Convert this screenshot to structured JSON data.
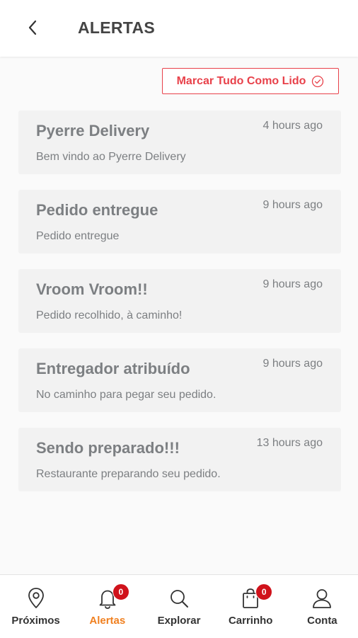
{
  "header": {
    "title": "ALERTAS"
  },
  "mark_all_label": "Marcar Tudo Como Lido",
  "alerts": [
    {
      "title": "Pyerre Delivery",
      "time": "4 hours ago",
      "message": "Bem vindo ao Pyerre Delivery"
    },
    {
      "title": "Pedido entregue",
      "time": "9 hours ago",
      "message": "Pedido entregue"
    },
    {
      "title": "Vroom Vroom!!",
      "time": "9 hours ago",
      "message": "Pedido recolhido, à caminho!"
    },
    {
      "title": "Entregador atribuído",
      "time": "9 hours ago",
      "message": "No caminho para pegar seu pedido."
    },
    {
      "title": "Sendo preparado!!!",
      "time": "13 hours ago",
      "message": "Restaurante preparando seu pedido."
    }
  ],
  "nav": [
    {
      "label": "Próximos",
      "icon": "location-pin-icon"
    },
    {
      "label": "Alertas",
      "icon": "bell-icon",
      "badge": "0",
      "active": true
    },
    {
      "label": "Explorar",
      "icon": "search-icon"
    },
    {
      "label": "Carrinho",
      "icon": "shopping-bag-icon",
      "badge": "0"
    },
    {
      "label": "Conta",
      "icon": "user-icon"
    }
  ],
  "colors": {
    "accent": "#e8414a",
    "active_nav": "#f08020",
    "badge": "#d0121b"
  }
}
